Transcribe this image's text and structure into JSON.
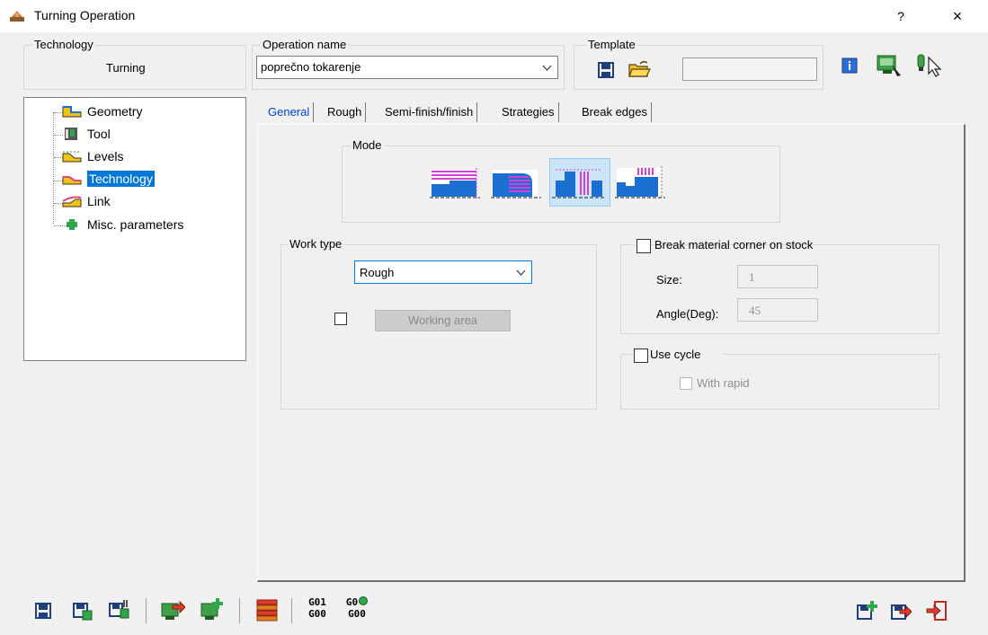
{
  "window": {
    "title": "Turning Operation",
    "help_label": "?",
    "close_label": "×"
  },
  "technology": {
    "group_label": "Technology",
    "value": "Turning"
  },
  "operation": {
    "group_label": "Operation name",
    "value": "poprečno tokarenje"
  },
  "template": {
    "group_label": "Template",
    "field_value": ""
  },
  "tree": {
    "items": [
      {
        "label": "Geometry",
        "icon": "geometry-icon"
      },
      {
        "label": "Tool",
        "icon": "tool-icon"
      },
      {
        "label": "Levels",
        "icon": "levels-icon"
      },
      {
        "label": "Technology",
        "icon": "technology-icon",
        "selected": true
      },
      {
        "label": "Link",
        "icon": "link-icon"
      },
      {
        "label": "Misc. parameters",
        "icon": "plus-icon"
      }
    ]
  },
  "tabs": [
    {
      "label": "General",
      "active": true
    },
    {
      "label": "Rough"
    },
    {
      "label": "Semi-finish/finish"
    },
    {
      "label": "Strategies"
    },
    {
      "label": "Break edges"
    }
  ],
  "general": {
    "mode_label": "Mode",
    "mode_selected_index": 2,
    "work_type_label": "Work type",
    "work_type_value": "Rough",
    "working_area_label": "Working area",
    "break_corner_label": "Break material corner on stock",
    "size_label": "Size:",
    "size_value": "1",
    "angle_label": "Angle(Deg):",
    "angle_value": "45",
    "use_cycle_label": "Use cycle",
    "with_rapid_label": "With rapid"
  },
  "gcode": {
    "btn1_top": "G01",
    "btn1_bottom": "G00",
    "btn2_top": "G0",
    "btn2_bottom": "G00"
  },
  "colors": {
    "selection": "#0078d7",
    "tab_active_text": "#0046c8",
    "mode_highlight": "#cce4f7",
    "magenta": "#d63fd6",
    "blue_icon": "#1a6fd0"
  }
}
